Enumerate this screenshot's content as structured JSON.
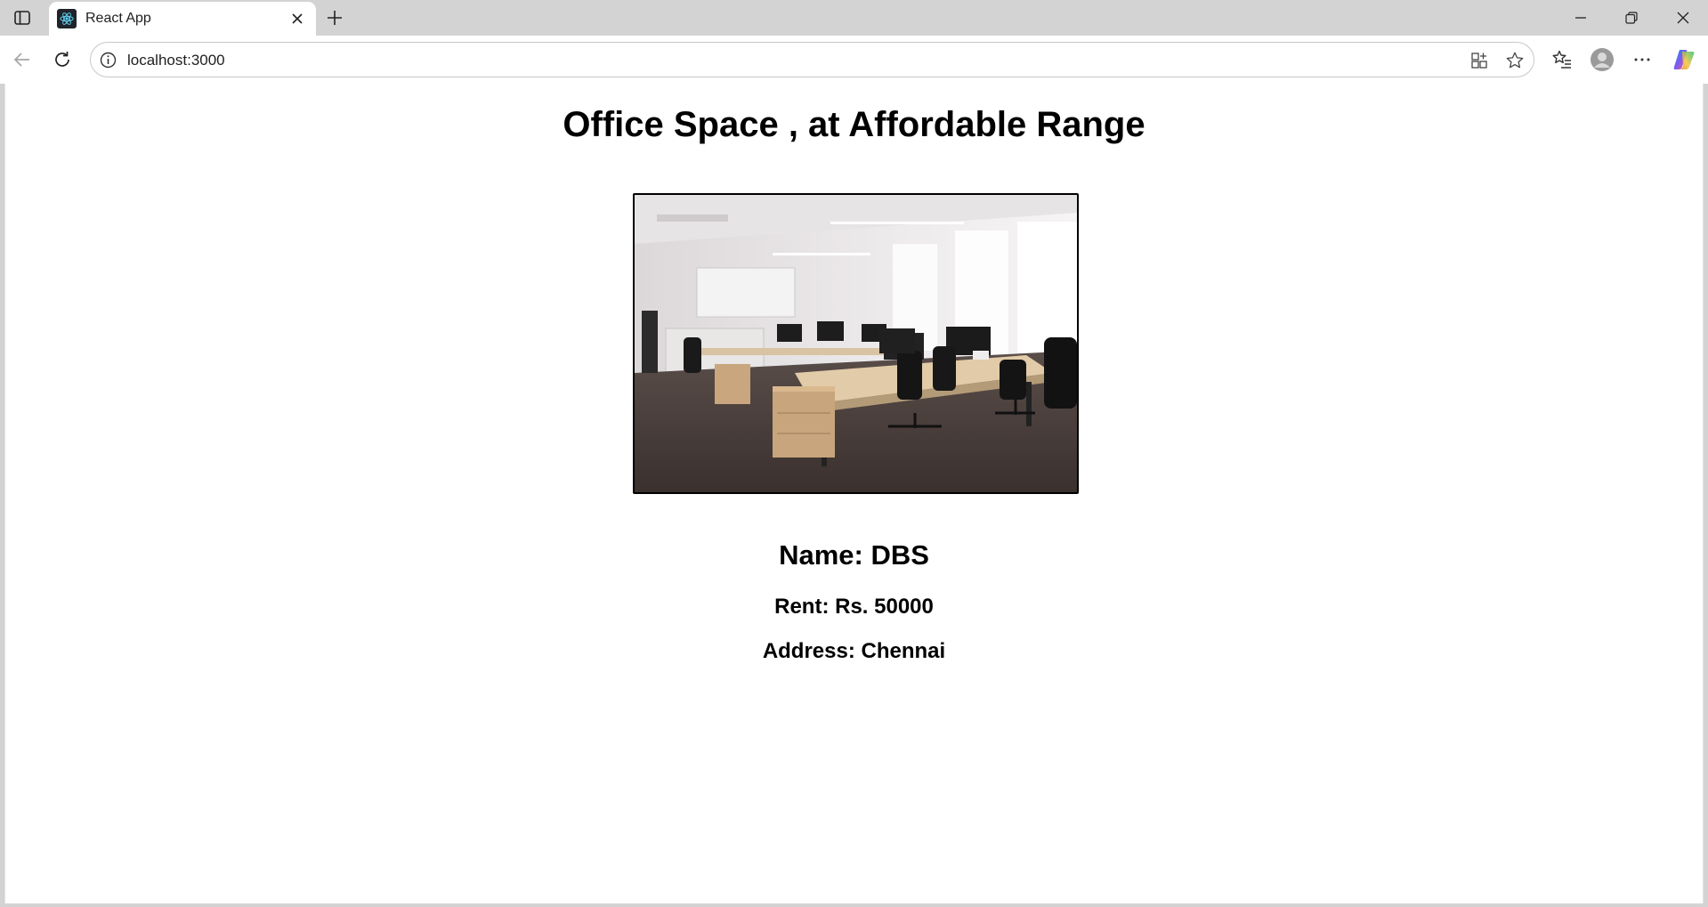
{
  "browser": {
    "tab_title": "React App",
    "url": "localhost:3000",
    "icons": {
      "sidebar": "sidebar-toggle-icon",
      "favicon": "react-logo-icon",
      "tab_close": "close-icon",
      "new_tab": "plus-icon",
      "minimize": "minimize-icon",
      "restore": "restore-icon",
      "close_window": "close-icon",
      "back": "back-arrow-icon",
      "reload": "reload-icon",
      "site_info": "info-icon",
      "app_available": "app-grid-icon",
      "favorite": "star-icon",
      "favorites": "favorites-list-icon",
      "profile": "avatar-icon",
      "more": "more-icon",
      "copilot": "copilot-icon"
    }
  },
  "page": {
    "title": "Office Space , at Affordable Range",
    "image_alt": "office-photo",
    "name": "Name: DBS",
    "rent": "Rent: Rs. 50000",
    "address": "Address: Chennai"
  }
}
